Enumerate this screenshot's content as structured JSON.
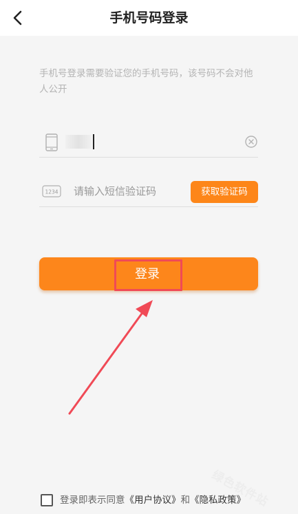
{
  "header": {
    "title": "手机号码登录",
    "back_icon": "chevron-left-icon"
  },
  "hint": "手机号登录需要验证您的手机号码，该号码不会对他人公开",
  "phone": {
    "icon": "mobile-phone-icon",
    "value": "••••",
    "clear_icon": "clear-circle-icon"
  },
  "code": {
    "icon": "numeric-keypad-icon",
    "icon_text": "1234",
    "placeholder": "请输入短信验证码",
    "get_code_label": "获取验证码"
  },
  "login": {
    "label": "登录"
  },
  "agreement": {
    "text_prefix": "登录即表示同意",
    "user_agreement": "《用户协议》",
    "conjunction": "和",
    "privacy_policy": "《隐私政策》"
  },
  "watermark": "绿色软件站",
  "colors": {
    "accent": "#fd8619",
    "annotation": "#f04a56"
  }
}
